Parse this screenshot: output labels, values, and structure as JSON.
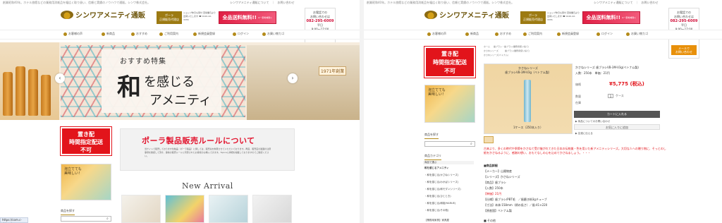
{
  "common": {
    "top_strip": "創業昭和40年。ホテル旅館などの業務用消耗品を幅広く取り扱い、信頼と実績のノウハウで通販。シンワ株式会社。",
    "top_links": "シンワアメニティ通販について　｜　お問い合わせ",
    "logo_text": "シンワアメニティ通販",
    "poler_badge_line1": "ポーラ",
    "poler_badge_line2": "正規販売代理店",
    "poler_info": "ショップ休日も受付 翌営業日より出荷いたします ☎ 0120-42-3355",
    "free_ship": "全品送料無料!!",
    "free_ship_note": "※一部地域除く",
    "contact_line1": "お電話での",
    "contact_line2": "お問い合わせは",
    "contact_phone": "082-295-6009",
    "contact_hours1": "平日",
    "contact_hours2": "9:00〜17:00",
    "contact_hours3": "(土日祝除きます)",
    "contact_mail1": "メールで",
    "contact_mail2": "お問い合わせ",
    "nav": [
      "お客様の声",
      "新商品",
      "おすすめ",
      "ご利用案内",
      "新規会員登録",
      "ログイン",
      "お買い物カゴ"
    ]
  },
  "left": {
    "hero_sub": "おすすめ特集",
    "hero_big": "和",
    "hero_big2": "を感じる",
    "hero_big3": "アメニティ",
    "hero_year": "1971年創業",
    "arrow_prev": "‹",
    "arrow_next": "›",
    "badge_line1": "置き配",
    "badge_line2": "時間指定配送",
    "badge_line3": "不可",
    "rule_title": "ポーラ製品販売ルールについて",
    "rule_text": "当サイトで販売しております化粧品（ポーラ製品）に関しては、販売先を制限させていただいております。再度、販売店の範囲の注意事項を確認して頂き、事前の販売ルールに同意されたお客様のみ購入できます。Topicsに詳細を掲載しておりますのでご確認ください。",
    "side_img_text1": "泡立てても",
    "side_img_text2": "美味しい！",
    "new_arrival": "New Arrival",
    "search_label": "商品を探す",
    "url_tip": "https://com.c-shinw.jp"
  },
  "right": {
    "crumbs": [
      "ホーム",
      "歯ブラシ・歯ブラシ(業務用使い捨て)",
      "かさねシリーズ",
      "歯ブラシ(業務用使い捨て)",
      "かさねシリーズ(ベトナム)"
    ],
    "badge_line1": "置き配",
    "badge_line2": "時間指定配送",
    "badge_line3": "不可",
    "img_title": "かさねシリーズ",
    "img_sub": "歯ブラシVB-3M-V3g（ベトナム製）",
    "img_caption": "1ケース（250本入り）",
    "pd_name": "かさねシリーズ 歯ブラシVB-3M-V3g(ベトナム製)",
    "pd_spec": "入数：250本　単価：21円",
    "price_label": "価格",
    "price": "¥5,775 (税込)",
    "qty_label": "数量",
    "qty_value": "1",
    "qty_unit": "ケース",
    "stock_label": "在庫",
    "cart_btn": "カートに入れる",
    "inquiry_link": "▶ 商品についてのお問い合わせ",
    "fav_btn": "お気に入りに追加",
    "review_link": "▶ 友達に伝える",
    "red_desc": "古来より、多くの時代や季節をかさねて受け継がれてきた日本の伝統美・色を用いた新アメニティシリーズ。大切な人への贈り物に、そっとのし紙をかさねるように、感謝の想い、おもてなしの心を込めてかさねましょう。・・・",
    "spec_heading": "■商品詳細",
    "spec_lines": [
      "【メーカー】山陽物産",
      "【シリーズ】かさねシリーズ",
      "【商品】歯ブラシ",
      "【入数】250本",
      "【単価】21円",
      "【仕様】歯ブラシ/PBT毛　／歯磨き粉3gチューブ",
      "【寸法】本体:158mm（柄の長さ）／歯:41×220",
      "【原産国】ベトナム製"
    ],
    "side_search_label": "商品を探す",
    "side_cat_label": "商品カテゴリ",
    "side_cat_head": "商品で選ぶ",
    "side_menu": [
      "和を感じるアメニティ",
      "・和を感じる(かさねシリーズ)",
      "・和を感じる(わかばシリーズ)",
      "・和を感じる(和モダンシリーズ)",
      "・和を感じる(ひととき)",
      "・和を感じる(和桜/HARUE)",
      "・和を感じる(その他)"
    ],
    "side_footer_label": "【業務用家具】家具屋",
    "side_footer2": "■ その他"
  }
}
